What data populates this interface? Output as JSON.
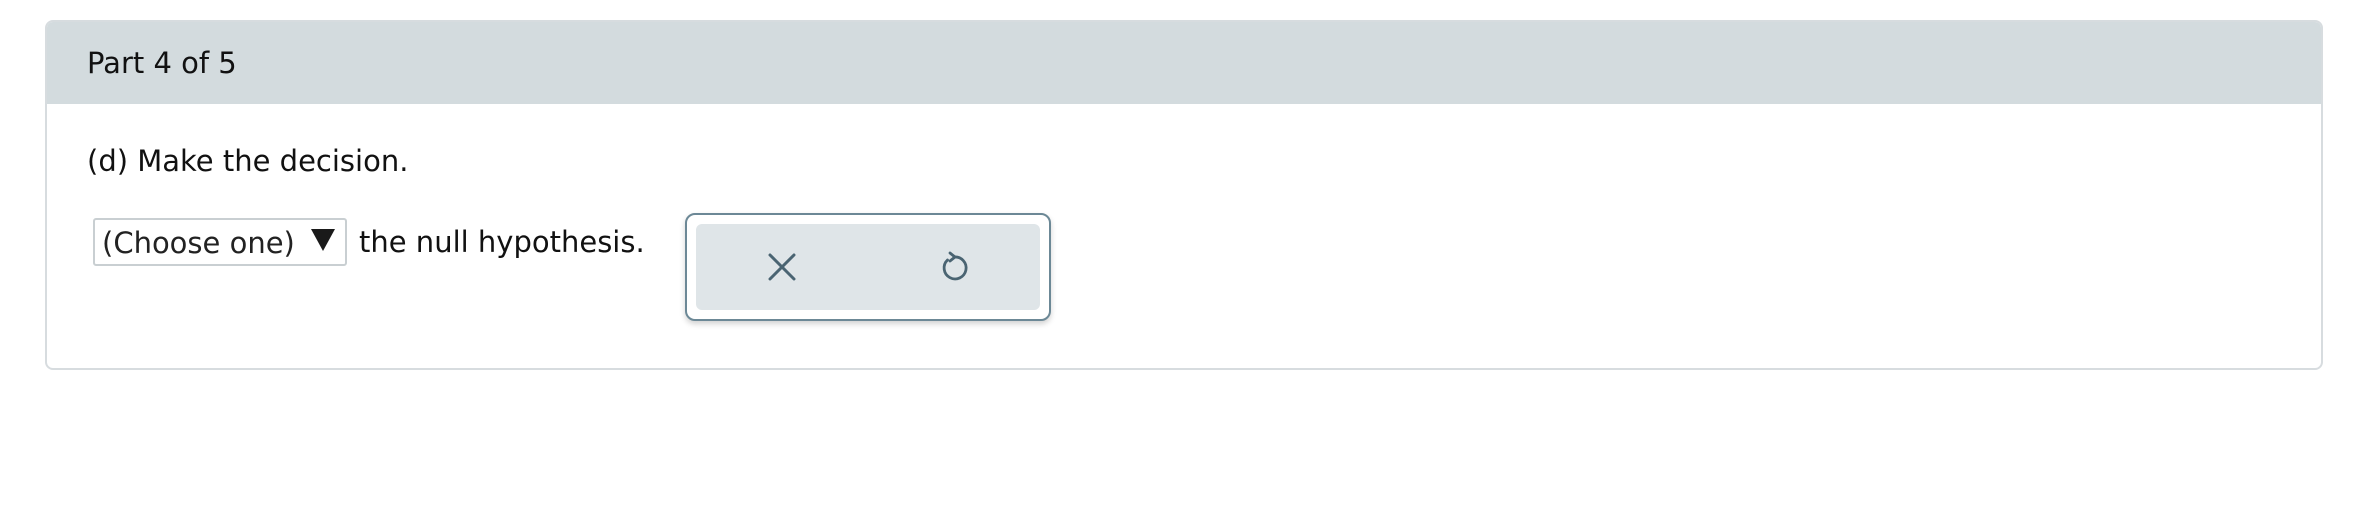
{
  "header": {
    "part_label": "Part 4 of 5"
  },
  "question": {
    "text": "(d) Make the decision."
  },
  "answer": {
    "select_value": "(Choose one)",
    "after_text": "the null hypothesis."
  },
  "toolbar": {
    "clear_icon": "x-icon",
    "reset_icon": "undo-icon",
    "icon_color": "#4a6472"
  }
}
